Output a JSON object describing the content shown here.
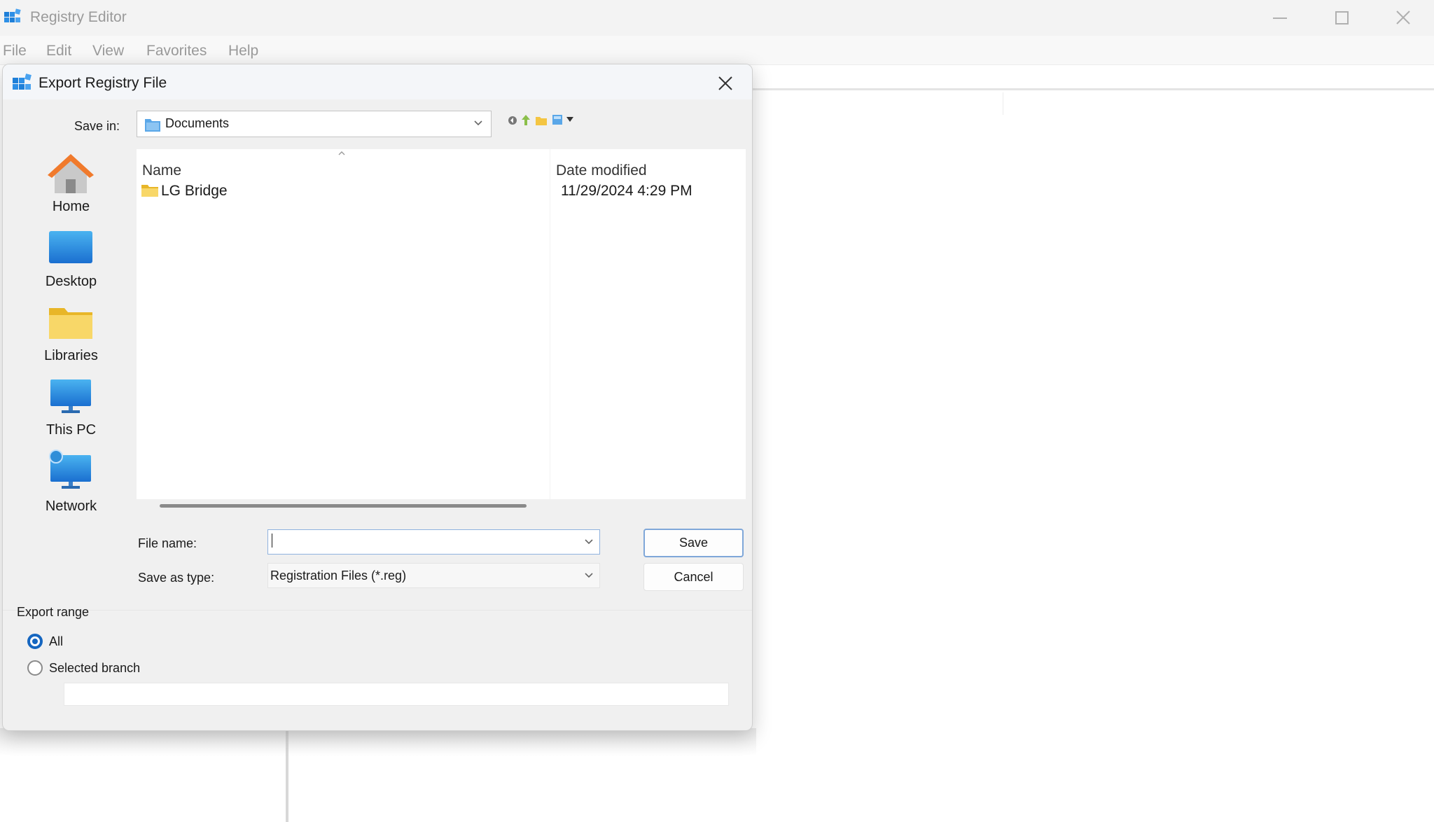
{
  "window": {
    "title": "Registry Editor",
    "menu": [
      "File",
      "Edit",
      "View",
      "Favorites",
      "Help"
    ]
  },
  "dialog": {
    "title": "Export Registry File",
    "save_in_label": "Save in:",
    "save_in_value": "Documents",
    "places": [
      {
        "label": "Home",
        "icon": "home-icon"
      },
      {
        "label": "Desktop",
        "icon": "desktop-icon"
      },
      {
        "label": "Libraries",
        "icon": "libraries-icon"
      },
      {
        "label": "This PC",
        "icon": "this-pc-icon"
      },
      {
        "label": "Network",
        "icon": "network-icon"
      }
    ],
    "columns": {
      "name": "Name",
      "date_modified": "Date modified"
    },
    "files": [
      {
        "name": "LG Bridge",
        "date_modified": "11/29/2024 4:29 PM",
        "type": "folder"
      }
    ],
    "file_name_label": "File name:",
    "file_name_value": "",
    "save_as_type_label": "Save as type:",
    "save_as_type_value": "Registration Files (*.reg)",
    "save_button": "Save",
    "cancel_button": "Cancel",
    "export_range_label": "Export range",
    "range_options": [
      {
        "label": "All",
        "selected": true
      },
      {
        "label": "Selected branch",
        "selected": false
      }
    ],
    "selected_branch_value": ""
  },
  "colors": {
    "accent": "#1566c0",
    "dialog_bg": "#f0f0f0",
    "folder_yellow": "#f4c542"
  }
}
